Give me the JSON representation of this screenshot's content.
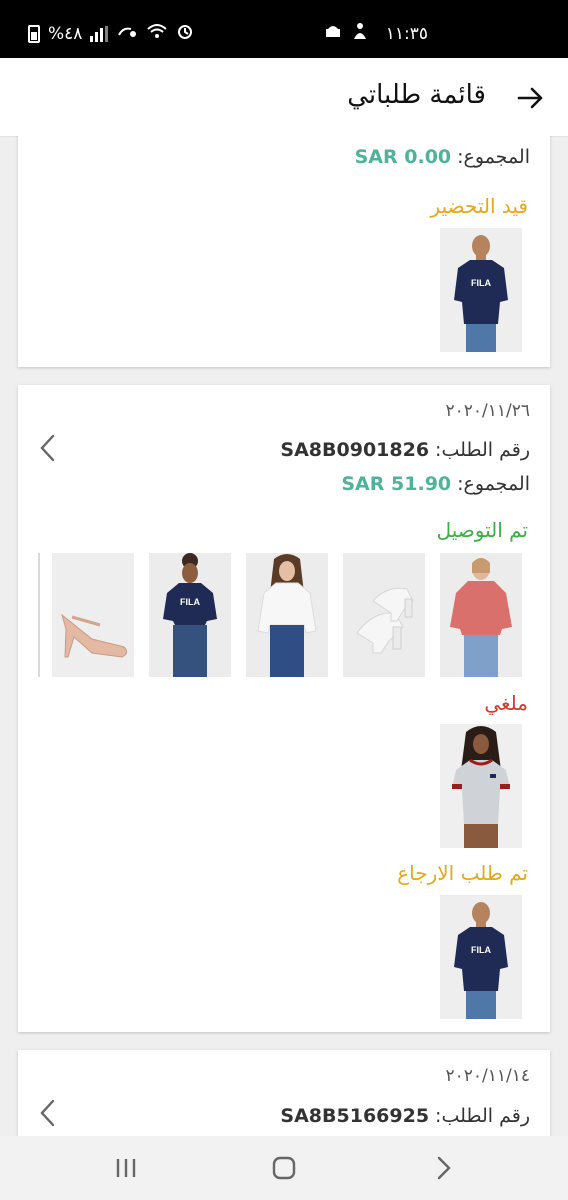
{
  "status_bar": {
    "time": "١١:٣٥",
    "battery": "%٤٨"
  },
  "header": {
    "title": "قائمة طلباتي"
  },
  "labels": {
    "order_no": "رقم الطلب:",
    "total": "المجموع:"
  },
  "orders": [
    {
      "total": "0.00 SAR",
      "groups": [
        {
          "status": "قيد التحضير",
          "status_color": "#e6a817"
        }
      ]
    },
    {
      "date": "٢٠٢٠/١١/٢٦",
      "order_no": "SA8B0901826",
      "total": "51.90 SAR",
      "groups": [
        {
          "status": "تم التوصيل",
          "status_color": "#3fae49"
        },
        {
          "status": "ملغي",
          "status_color": "#d03b2f"
        },
        {
          "status": "تم طلب الارجاع",
          "status_color": "#e6a817"
        }
      ]
    },
    {
      "date": "٢٠٢٠/١١/١٤",
      "order_no": "SA8B5166925"
    }
  ],
  "colors": {
    "total_value": "#4fb39c",
    "status_preparing": "#e6a817",
    "status_delivered": "#3fae49",
    "status_cancelled": "#d03b2f"
  },
  "icons": {
    "back": "arrow-right-icon",
    "card_chevron": "chevron-left-icon",
    "nav_recent": "recent-apps-icon",
    "nav_home": "home-icon",
    "nav_back": "chevron-right-icon"
  }
}
